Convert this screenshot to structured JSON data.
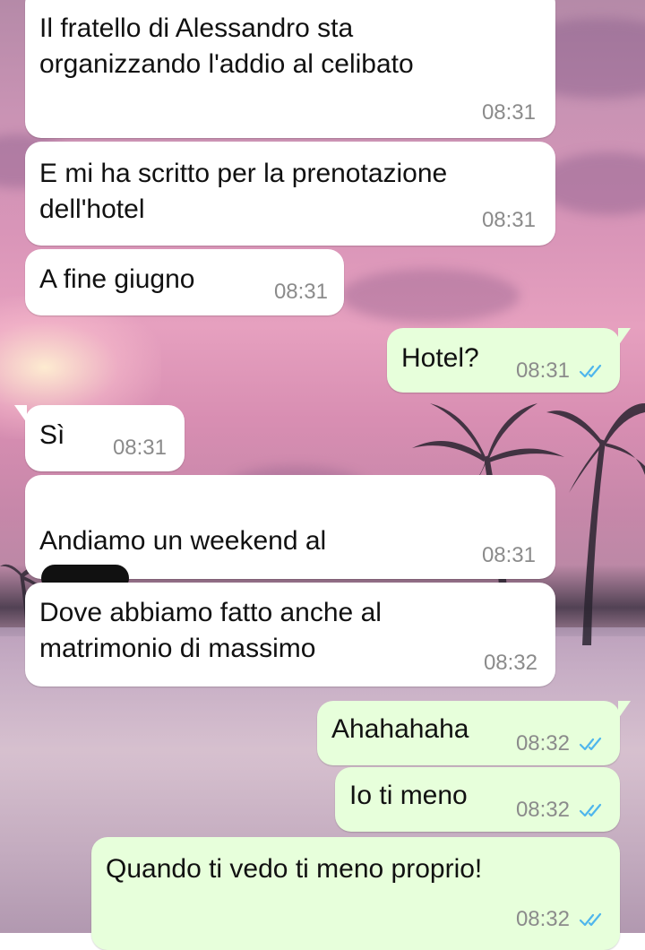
{
  "messages": [
    {
      "id": "m1",
      "direction": "incoming",
      "text": "Il fratello di Alessandro sta\norganizzando l'addio al celibato",
      "time": "08:31"
    },
    {
      "id": "m2",
      "direction": "incoming",
      "text": "E mi ha scritto per la prenotazione\ndell'hotel",
      "time": "08:31"
    },
    {
      "id": "m3",
      "direction": "incoming",
      "text": "A fine giugno",
      "time": "08:31"
    },
    {
      "id": "m4",
      "direction": "outgoing",
      "text": "Hotel?",
      "time": "08:31",
      "status_icon": "double-check-read-icon"
    },
    {
      "id": "m5",
      "direction": "incoming",
      "text": "Sì",
      "time": "08:31"
    },
    {
      "id": "m6",
      "direction": "incoming",
      "text": "Andiamo un weekend al",
      "time": "08:31",
      "redacted": true
    },
    {
      "id": "m7",
      "direction": "incoming",
      "text": "Dove abbiamo fatto anche al\nmatrimonio di massimo",
      "time": "08:32"
    },
    {
      "id": "m8",
      "direction": "outgoing",
      "text": "Ahahahaha",
      "time": "08:32",
      "status_icon": "double-check-read-icon"
    },
    {
      "id": "m9",
      "direction": "outgoing",
      "text": "Io ti meno",
      "time": "08:32",
      "status_icon": "double-check-read-icon"
    },
    {
      "id": "m10",
      "direction": "outgoing",
      "text": "Quando ti vedo ti meno proprio!",
      "time": "08:32",
      "status_icon": "double-check-read-icon"
    }
  ],
  "colors": {
    "incoming_bubble": "#ffffff",
    "outgoing_bubble": "#e7ffdb",
    "timestamp": "#8b8b8b",
    "read_ticks": "#4fb6ec"
  },
  "wallpaper": "pink-sunset-beach-with-palms"
}
